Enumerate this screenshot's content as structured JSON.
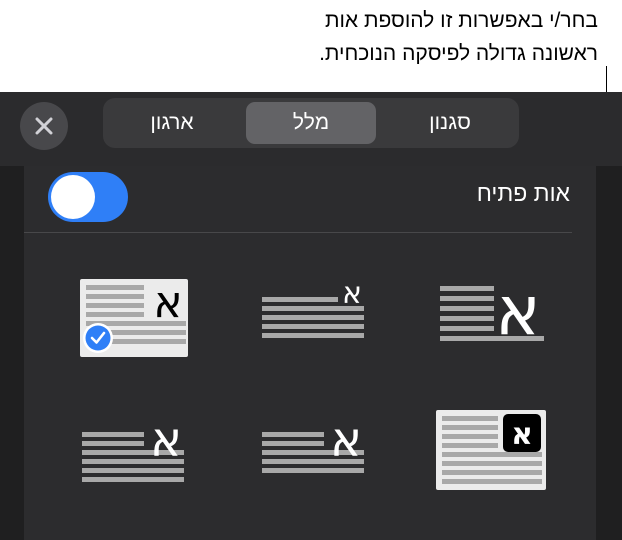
{
  "callout": {
    "line1": "בחר/י באפשרות זו להוספת אות",
    "line2": "ראשונה גדולה לפיסקה הנוכחית."
  },
  "toolbar": {
    "close_icon": "close-icon",
    "tabs": [
      {
        "label": "סגנון",
        "active": false
      },
      {
        "label": "מלל",
        "active": true
      },
      {
        "label": "ארגון",
        "active": false
      }
    ]
  },
  "drop_cap": {
    "label": "אות פתיח",
    "enabled": true,
    "accent_color": "#2f7ff7",
    "letter": "א",
    "selected_style": "boxed-corner",
    "styles": [
      {
        "id": "large-inline",
        "row": 1,
        "col": 1
      },
      {
        "id": "small-raised",
        "row": 1,
        "col": 2
      },
      {
        "id": "boxed-corner",
        "row": 1,
        "col": 3,
        "checked": true
      },
      {
        "id": "dark-box",
        "row": 2,
        "col": 1
      },
      {
        "id": "medium-inline-a",
        "row": 2,
        "col": 2
      },
      {
        "id": "medium-inline-b",
        "row": 2,
        "col": 3
      }
    ]
  }
}
